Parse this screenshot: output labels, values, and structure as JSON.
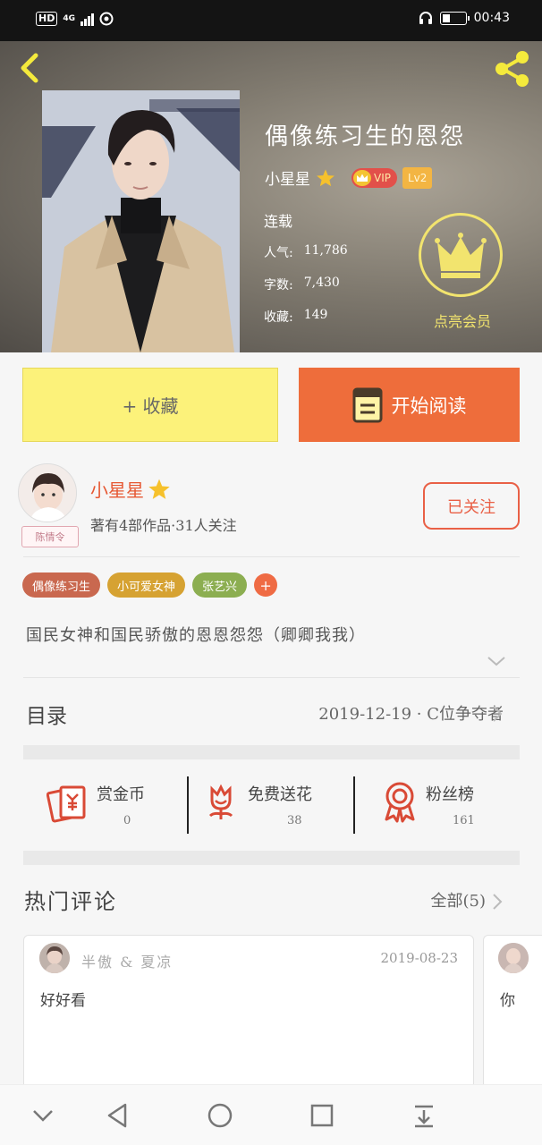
{
  "status_bar": {
    "hd": "HD",
    "network": "4G",
    "time": "00:43",
    "battery_level": 0.35
  },
  "header": {
    "back_icon": "chevron-left-icon",
    "share_icon": "share-icon",
    "book_title": "偶像练习生的恩怨",
    "author": "小星星",
    "vip_label": "VIP",
    "level_label": "Lv2",
    "status": "连载",
    "stats": [
      {
        "label": "人气:",
        "value": "11,786"
      },
      {
        "label": "字数:",
        "value": "7,430"
      },
      {
        "label": "收藏:",
        "value": "149"
      }
    ],
    "vip_promo_label": "点亮会员"
  },
  "actions": {
    "favorite_label": "+ 收藏",
    "read_label": "开始阅读"
  },
  "author_card": {
    "name": "小星星",
    "avatar_tag": "陈情令",
    "summary": "著有4部作品·31人关注",
    "follow_label": "已关注"
  },
  "tags": [
    {
      "label": "偶像练习生",
      "color": "#c9684f"
    },
    {
      "label": "小可爱女神",
      "color": "#d6a232"
    },
    {
      "label": "张艺兴",
      "color": "#8cae51"
    }
  ],
  "description": "国民女神和国民骄傲的恩恩怨怨（卿卿我我）",
  "toc": {
    "label": "目录",
    "latest": "2019-12-19 · C位争夺者"
  },
  "stats_row": [
    {
      "label": "赏金币",
      "value": "0",
      "icon": "red-envelope-icon"
    },
    {
      "label": "免费送花",
      "value": "38",
      "icon": "flower-icon"
    },
    {
      "label": "粉丝榜",
      "value": "161",
      "icon": "medal-icon"
    }
  ],
  "comments": {
    "title": "热门评论",
    "all_label": "全部(5)",
    "items": [
      {
        "user": "半傲 & 夏凉",
        "date": "2019-08-23",
        "text": "好好看"
      },
      {
        "user": "",
        "date": "",
        "text": "你"
      }
    ]
  },
  "colors": {
    "accent_orange": "#ee6d3b",
    "fav_yellow": "#fcf27a",
    "vip_yellow": "#f2e46e"
  }
}
